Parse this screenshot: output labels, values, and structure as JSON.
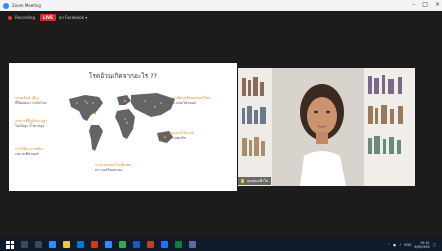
{
  "window": {
    "title": "Zoom Meeting"
  },
  "meeting_bar": {
    "recording_label": "Recording",
    "live_label": "LIVE",
    "stream_label": "on Facebook ▾"
  },
  "slide": {
    "title": "โรคอ้วนเกิดจากอะไร ??",
    "callouts": [
      {
        "heading": "กรรมพันธุ์ (ยีน)",
        "body": "ที่มีผลต่อการเกิดโรค"
      },
      {
        "heading": "อาหารที่มีพลังงานสูง",
        "body": "ไขมันสูง น้ำตาลสูง"
      },
      {
        "heading": "การใช้ยาบางชนิด",
        "body": "เช่น สเตียรอยด์"
      },
      {
        "heading": "ความผิดปกติของต่อมไร้ท่อ",
        "body": "เช่น ต่อมไทรอยด์"
      },
      {
        "heading": "ไม่ออกกำลังกาย",
        "body": "สาเหตุหลัก"
      },
      {
        "heading": "การนอนหลับไม่เพียงพอ",
        "body": "ความเครียดสะสม"
      }
    ]
  },
  "video": {
    "participant_name": "คุณหมอฟ้าใส"
  },
  "taskbar": {
    "time": "19:41",
    "date": "6/9/2565",
    "language": "ENG"
  },
  "colors": {
    "live": "#d82c2c",
    "callout_heading": "#e08a2c",
    "map_dots": "#4a4a4a"
  }
}
